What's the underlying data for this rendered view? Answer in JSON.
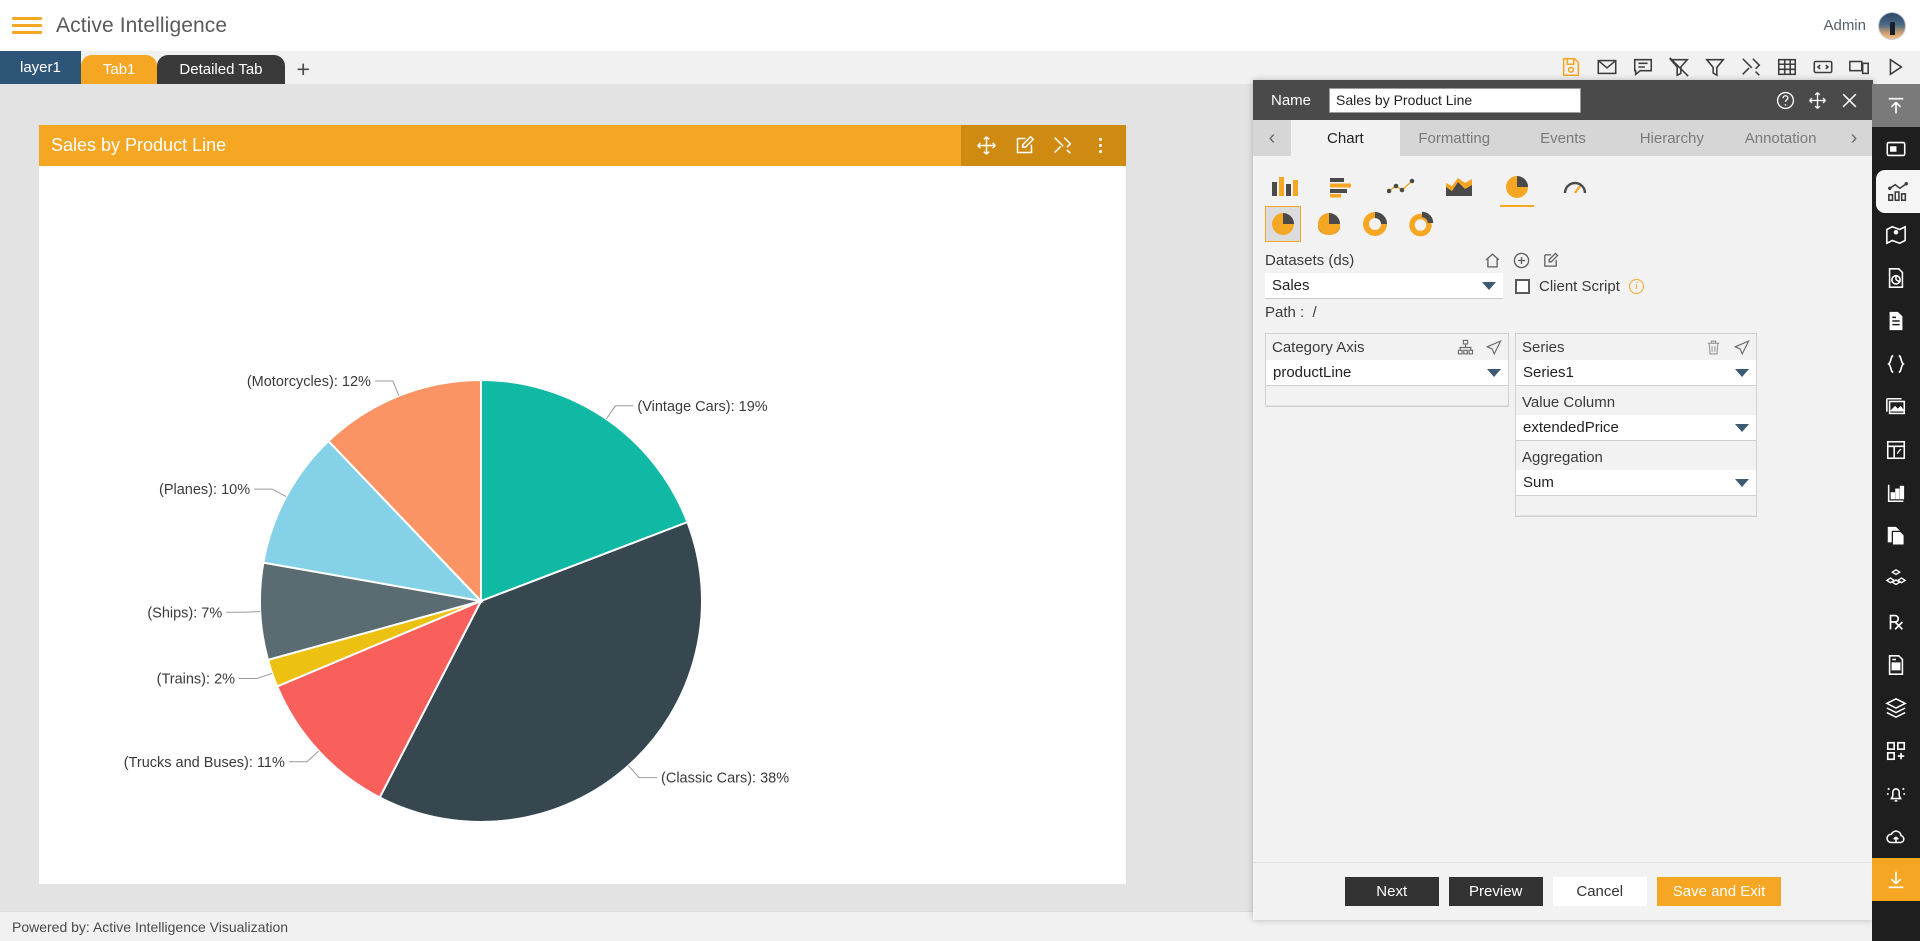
{
  "topbar": {
    "menu_icon": "hamburger-icon",
    "app_title": "Active Intelligence",
    "user_label": "Admin",
    "avatar_icon": "user-avatar"
  },
  "tabstrip": {
    "layer_tab": "layer1",
    "page_tabs": [
      {
        "label": "Tab1",
        "state": "active"
      },
      {
        "label": "Detailed Tab",
        "state": "inactive"
      }
    ],
    "add_tab_label": "+",
    "icons": [
      "save-icon",
      "mail-icon",
      "comment-icon",
      "clear-filter-icon",
      "filter-icon",
      "tools-icon",
      "table-icon",
      "code-icon",
      "responsive-icon",
      "play-icon"
    ]
  },
  "widget": {
    "title": "Sales by Product Line",
    "tool_icons": [
      "move-icon",
      "edit-icon",
      "settings-tools-icon",
      "more-vertical-icon"
    ]
  },
  "chart_data": {
    "type": "pie",
    "title": "Sales by Product Line",
    "xlabel": "",
    "ylabel": "",
    "label_format": "(category): percent%",
    "categories": [
      "Vintage Cars",
      "Classic Cars",
      "Trucks and Buses",
      "Trains",
      "Ships",
      "Planes",
      "Motorcycles"
    ],
    "values": [
      19,
      38,
      11,
      2,
      7,
      10,
      12
    ],
    "value_unit": "%",
    "labels": [
      "(Vintage Cars): 19%",
      "(Classic Cars): 38%",
      "(Trucks and Buses): 11%",
      "(Trains): 2%",
      "(Ships): 7%",
      "(Planes): 10%",
      "(Motorcycles): 12%"
    ],
    "colors": [
      "#0fb9a4",
      "#37474f",
      "#f9605c",
      "#edc112",
      "#5a6b72",
      "#85d2e8",
      "#fa9464"
    ],
    "legend": "none",
    "grid": false
  },
  "footer": {
    "text": "Powered by: Active Intelligence Visualization"
  },
  "panel": {
    "name_label": "Name",
    "name_value": "Sales by Product Line",
    "header_icons": [
      "help-icon",
      "move-icon",
      "close-icon"
    ],
    "prev_tab_icon": "chevron-left-icon",
    "next_tab_icon": "chevron-right-icon",
    "tabs": [
      {
        "label": "Chart",
        "state": "active"
      },
      {
        "label": "Formatting",
        "state": "inactive"
      },
      {
        "label": "Events",
        "state": "inactive"
      },
      {
        "label": "Hierarchy",
        "state": "inactive"
      },
      {
        "label": "Annotation",
        "state": "inactive"
      }
    ],
    "chart_types_row1": [
      "column-chart-icon",
      "bar-chart-icon",
      "scatter-chart-icon",
      "area-chart-icon",
      "pie-chart-icon",
      "gauge-chart-icon"
    ],
    "chart_types_row2": [
      "pie-plain-icon",
      "pie-3d-icon",
      "donut-icon",
      "donut-exploded-icon"
    ],
    "datasets": {
      "label": "Datasets (ds)",
      "icons": [
        "home-icon",
        "add-circle-icon",
        "edit-icon"
      ],
      "selected": "Sales",
      "path_label": "Path :",
      "path_value": "/"
    },
    "client_script": {
      "label": "Client Script",
      "checked": false,
      "info_icon": "info-icon"
    },
    "category_axis": {
      "label": "Category Axis",
      "icons": [
        "hierarchy-icon",
        "send-icon"
      ],
      "selected": "productLine"
    },
    "series": {
      "label": "Series",
      "icons": [
        "trash-icon",
        "send-icon"
      ],
      "selected": "Series1",
      "value_column_label": "Value Column",
      "value_column": "extendedPrice",
      "aggregation_label": "Aggregation",
      "aggregation": "Sum"
    },
    "buttons": {
      "next": "Next",
      "preview": "Preview",
      "cancel": "Cancel",
      "save_exit": "Save and Exit"
    }
  },
  "rail": {
    "icons": [
      "collapse-up-icon",
      "widget-icon",
      "chart-icon",
      "map-icon",
      "report-pie-icon",
      "document-icon",
      "braces-icon",
      "image-icon",
      "layout-icon",
      "kpi-icon",
      "copy-page-icon",
      "cubes-icon",
      "rx-icon",
      "doc-settings-icon",
      "layers-icon",
      "add-grid-icon",
      "alert-bell-icon",
      "cloud-upload-icon",
      "download-icon"
    ]
  },
  "colors": {
    "accent": "#f5a623",
    "dark": "#333333",
    "panel_header": "#4a4a4a",
    "layer_tab": "#2d5578",
    "canvas": "#e3e3e3"
  }
}
